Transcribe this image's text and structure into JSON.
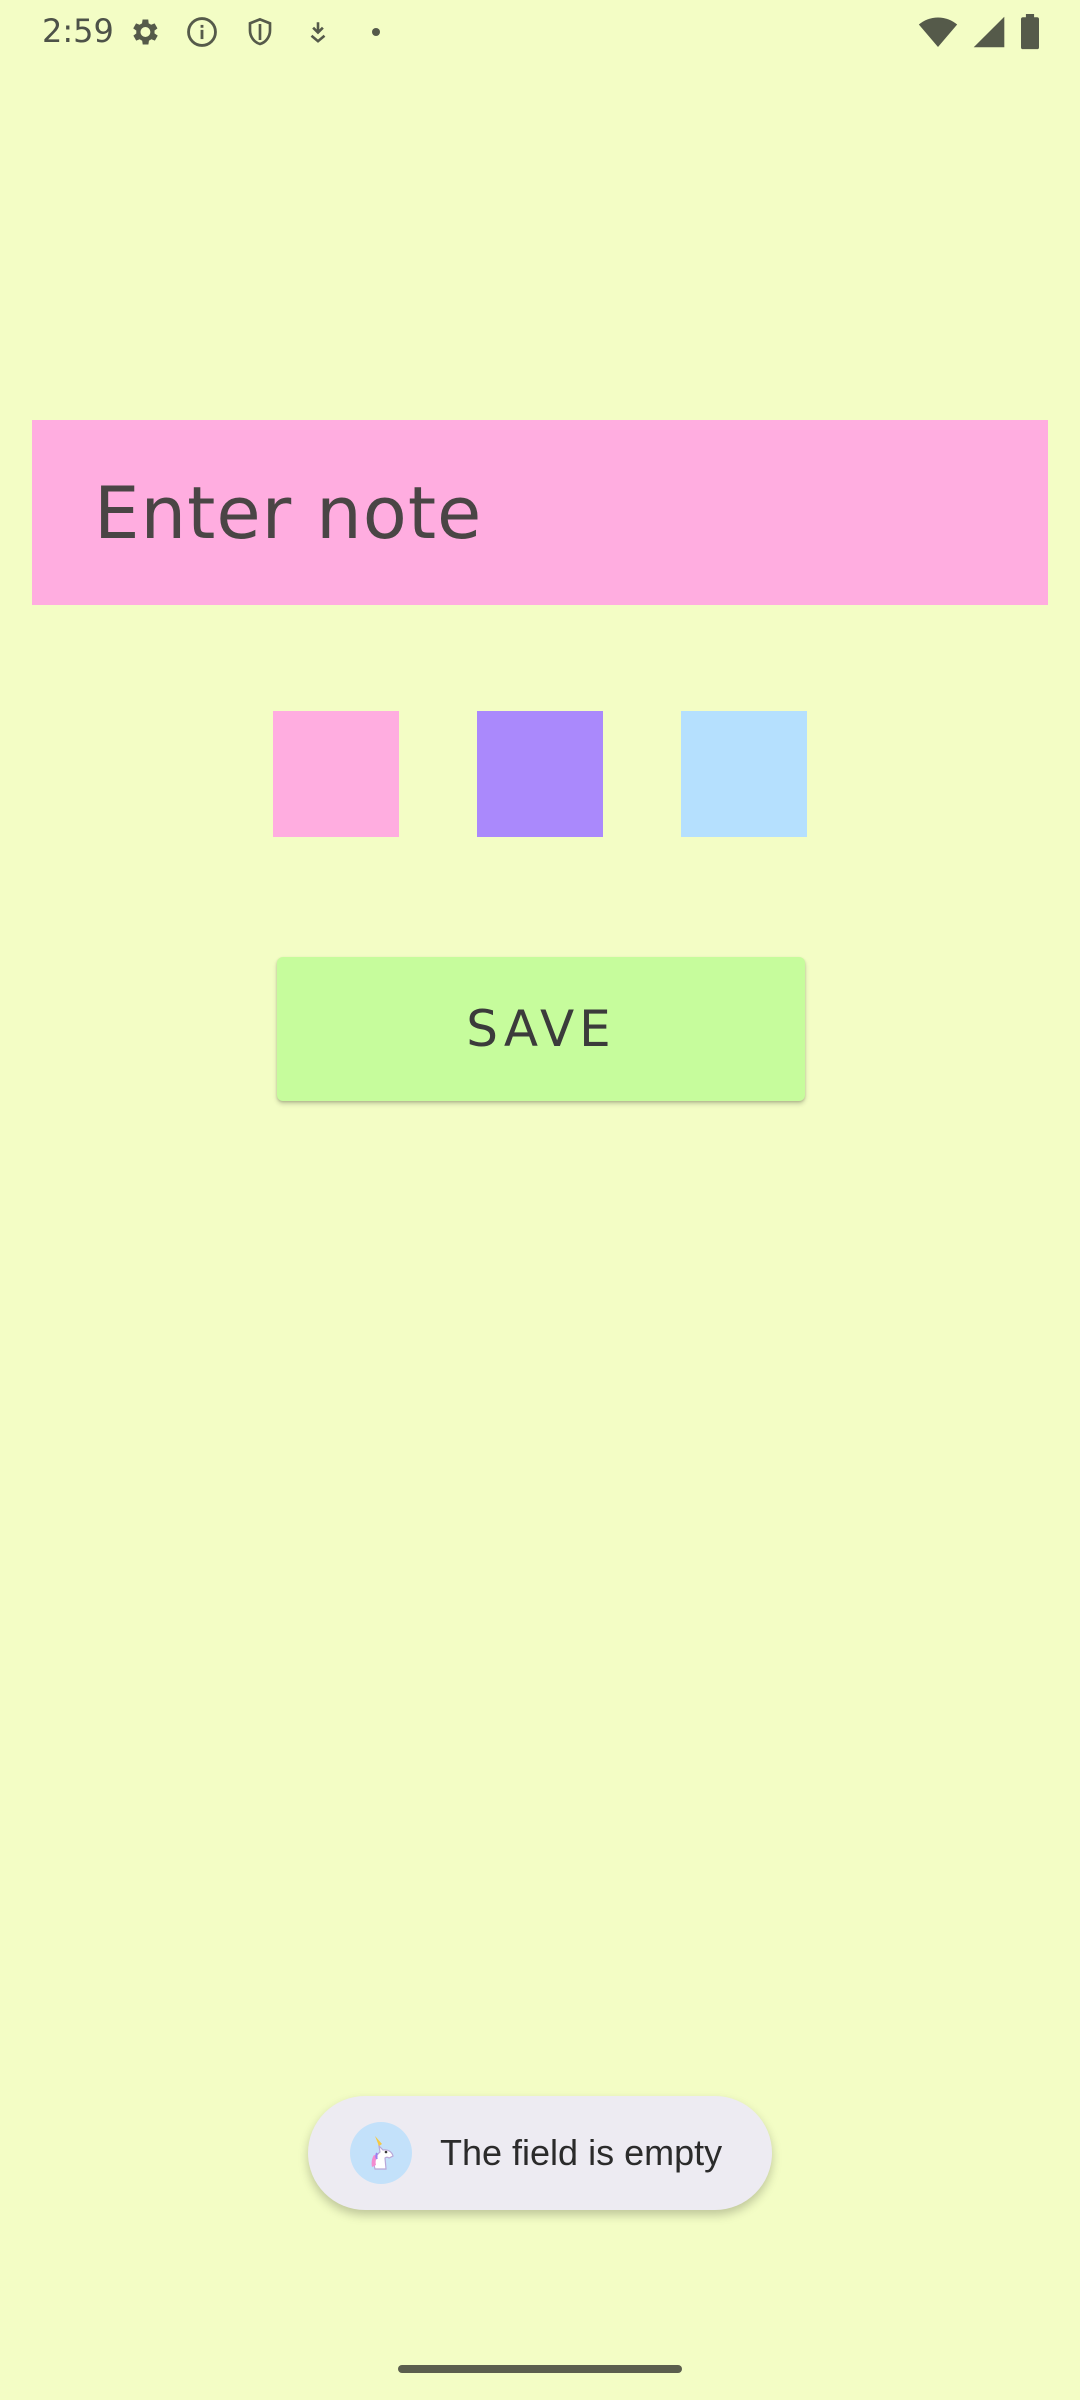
{
  "status_bar": {
    "time": "2:59",
    "left_icons": [
      "settings-icon",
      "info-icon",
      "shield-icon",
      "download-icon",
      "dot-icon"
    ],
    "right_icons": [
      "wifi-icon",
      "signal-icon",
      "battery-icon"
    ]
  },
  "note_input": {
    "placeholder": "Enter note",
    "value": "",
    "background": "#FFADE0"
  },
  "color_swatches": [
    {
      "name": "pink",
      "color": "#FFADE0"
    },
    {
      "name": "purple",
      "color": "#AA89FC"
    },
    {
      "name": "blue",
      "color": "#B5E0FE"
    }
  ],
  "save_button": {
    "label": "SAVE",
    "background": "#C6FC9C"
  },
  "toast": {
    "icon": "unicorn-icon",
    "message": "The field is empty"
  },
  "colors": {
    "background": "#F3FDC5"
  }
}
